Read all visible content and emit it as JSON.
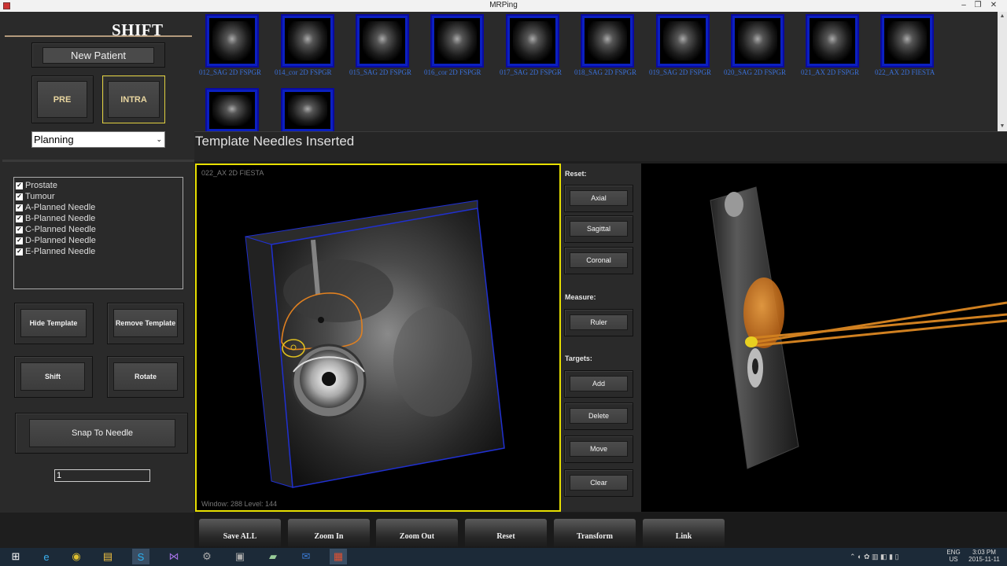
{
  "window": {
    "title": "MRPing"
  },
  "left": {
    "logo": "SHIFT",
    "new_patient": "New Patient",
    "pre": "PRE",
    "intra": "INTRA",
    "mode_value": "Planning",
    "structures": [
      "Prostate",
      "Tumour",
      "A-Planned Needle",
      "B-Planned Needle",
      "C-Planned Needle",
      "D-Planned Needle",
      "E-Planned Needle"
    ],
    "hide_template": "Hide Template",
    "remove_template": "Remove Template",
    "shift": "Shift",
    "rotate": "Rotate",
    "snap": "Snap To Needle",
    "needle_value": "1"
  },
  "thumbnails": [
    "012_SAG 2D FSPGR",
    "014_cor 2D FSPGR",
    "015_SAG 2D FSPGR",
    "016_cor 2D FSPGR",
    "017_SAG 2D FSPGR",
    "018_SAG 2D FSPGR",
    "019_SAG 2D FSPGR",
    "020_SAG 2D FSPGR",
    "021_AX 2D FSPGR",
    "022_AX 2D FIESTA"
  ],
  "status": "Template Needles Inserted",
  "view2d": {
    "series": "022_AX 2D FIESTA",
    "window_level": "Window: 288  Level: 144"
  },
  "tools": {
    "reset_label": "Reset:",
    "axial": "Axial",
    "sagittal": "Sagittal",
    "coronal": "Coronal",
    "measure_label": "Measure:",
    "ruler": "Ruler",
    "targets_label": "Targets:",
    "add": "Add",
    "delete": "Delete",
    "move": "Move",
    "clear": "Clear"
  },
  "bottom": [
    "Save ALL",
    "Zoom In",
    "Zoom Out",
    "Reset",
    "Transform",
    "Link"
  ],
  "tray": {
    "lang": "ENG",
    "region": "US",
    "time": "3:03 PM",
    "date": "2015-11-11"
  },
  "colors": {
    "active_yellow": "#e8e000",
    "thumb_blue": "#0b20c0",
    "contour_orange": "#e08020"
  }
}
